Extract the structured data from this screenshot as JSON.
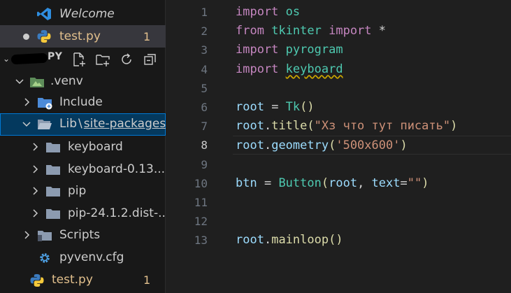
{
  "colors": {
    "sidebar_bg": "#181818",
    "editor_bg": "#1f1f1f",
    "selection": "#04395e",
    "focus_border": "#0078d4",
    "modified": "#e2c08d"
  },
  "open_editors": [
    {
      "label": "Welcome",
      "icon": "vscode-icon",
      "italic": true
    },
    {
      "label": "test.py",
      "icon": "python-icon",
      "modified": true,
      "badge": "1",
      "unsaved": true
    }
  ],
  "workspace": {
    "name": "PY",
    "actions": [
      "new-file-icon",
      "new-folder-icon",
      "refresh-icon",
      "collapse-all-icon"
    ]
  },
  "tree": [
    {
      "label": ".venv",
      "icon": "venv-folder-icon",
      "depth": 1,
      "expanded": true
    },
    {
      "label": "Include",
      "icon": "include-folder-icon",
      "depth": 2,
      "expanded": false
    },
    {
      "label": "Lib",
      "sublabel": "site-packages",
      "icon": "folder-open-icon",
      "depth": 2,
      "expanded": true,
      "selected": true
    },
    {
      "label": "keyboard",
      "icon": "folder-icon",
      "depth": 3,
      "expanded": false
    },
    {
      "label": "keyboard-0.13....",
      "icon": "folder-icon",
      "depth": 3,
      "expanded": false
    },
    {
      "label": "pip",
      "icon": "folder-icon",
      "depth": 3,
      "expanded": false
    },
    {
      "label": "pip-24.1.2.dist-...",
      "icon": "folder-icon",
      "depth": 3,
      "expanded": false
    },
    {
      "label": "Scripts",
      "icon": "scripts-folder-icon",
      "depth": 2,
      "expanded": false
    },
    {
      "label": "pyvenv.cfg",
      "icon": "gear-icon",
      "depth": 2
    },
    {
      "label": "test.py",
      "icon": "python-icon",
      "depth": 1,
      "modified": true,
      "badge": "1"
    }
  ],
  "editor": {
    "current_line": "8",
    "lines": [
      {
        "n": "1",
        "tokens": [
          {
            "t": "import",
            "c": "kw"
          },
          {
            "t": " "
          },
          {
            "t": "os",
            "c": "mod"
          }
        ]
      },
      {
        "n": "2",
        "tokens": [
          {
            "t": "from",
            "c": "kw"
          },
          {
            "t": " "
          },
          {
            "t": "tkinter",
            "c": "mod"
          },
          {
            "t": " "
          },
          {
            "t": "import",
            "c": "kw"
          },
          {
            "t": " *",
            "c": "op"
          }
        ]
      },
      {
        "n": "3",
        "tokens": [
          {
            "t": "import",
            "c": "kw"
          },
          {
            "t": " "
          },
          {
            "t": "pyrogram",
            "c": "mod"
          }
        ]
      },
      {
        "n": "4",
        "tokens": [
          {
            "t": "import",
            "c": "kw"
          },
          {
            "t": " "
          },
          {
            "t": "keyboard",
            "c": "mod squig"
          }
        ]
      },
      {
        "n": "5",
        "tokens": []
      },
      {
        "n": "6",
        "tokens": [
          {
            "t": "root",
            "c": "var"
          },
          {
            "t": " = ",
            "c": "op"
          },
          {
            "t": "Tk",
            "c": "mod"
          },
          {
            "t": "()",
            "c": "fn"
          }
        ]
      },
      {
        "n": "7",
        "tokens": [
          {
            "t": "root",
            "c": "var"
          },
          {
            "t": ".",
            "c": "op"
          },
          {
            "t": "title",
            "c": "fn"
          },
          {
            "t": "(",
            "c": "fn"
          },
          {
            "t": "\"Хз что тут писать\"",
            "c": "str"
          },
          {
            "t": ")",
            "c": "fn"
          }
        ]
      },
      {
        "n": "8",
        "tokens": [
          {
            "t": "root",
            "c": "var"
          },
          {
            "t": ".",
            "c": "op"
          },
          {
            "t": "geometry",
            "c": "var"
          },
          {
            "t": "(",
            "c": "fn"
          },
          {
            "t": "'500x600'",
            "c": "str"
          },
          {
            "t": ")",
            "c": "fn"
          }
        ]
      },
      {
        "n": "9",
        "tokens": []
      },
      {
        "n": "10",
        "tokens": [
          {
            "t": "btn",
            "c": "var"
          },
          {
            "t": " = ",
            "c": "op"
          },
          {
            "t": "Button",
            "c": "mod"
          },
          {
            "t": "(",
            "c": "fn"
          },
          {
            "t": "root",
            "c": "var"
          },
          {
            "t": ", ",
            "c": "op"
          },
          {
            "t": "text",
            "c": "var"
          },
          {
            "t": "=",
            "c": "op"
          },
          {
            "t": "\"\"",
            "c": "str"
          },
          {
            "t": ")",
            "c": "fn"
          }
        ]
      },
      {
        "n": "11",
        "tokens": []
      },
      {
        "n": "12",
        "tokens": []
      },
      {
        "n": "13",
        "tokens": [
          {
            "t": "root",
            "c": "var"
          },
          {
            "t": ".",
            "c": "op"
          },
          {
            "t": "mainloop",
            "c": "fn"
          },
          {
            "t": "()",
            "c": "fn"
          }
        ]
      }
    ]
  }
}
